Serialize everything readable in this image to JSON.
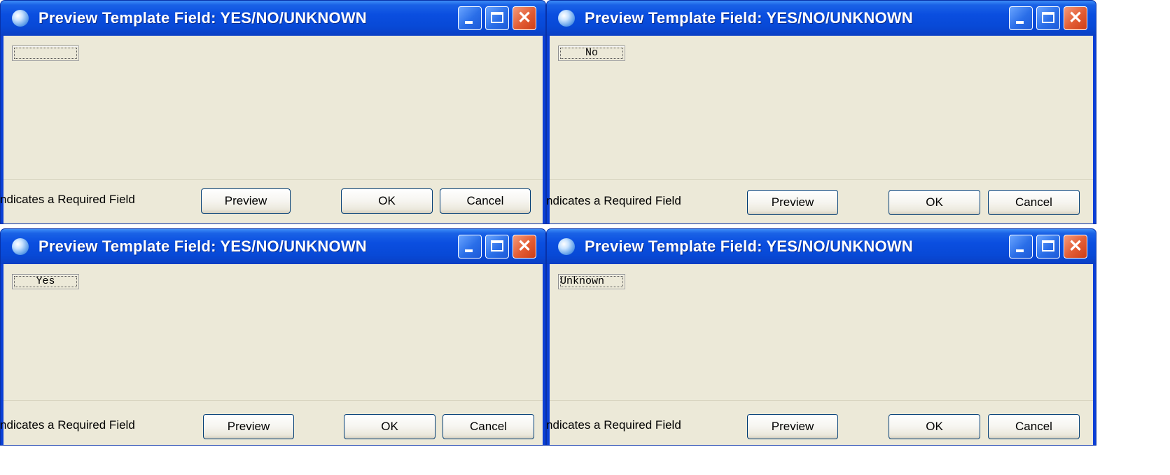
{
  "common": {
    "title": "Preview Template Field: YES/NO/UNKNOWN",
    "required_text": "ndicates a Required Field",
    "preview_label": "Preview",
    "ok_label": "OK",
    "cancel_label": "Cancel",
    "close_glyph": "✕"
  },
  "windows": [
    {
      "field_value": ""
    },
    {
      "field_value": "No"
    },
    {
      "field_value": "Yes"
    },
    {
      "field_value": "Unknown"
    }
  ],
  "colors": {
    "titlebar": "#0a4ee0",
    "client": "#ece9d8",
    "close_button": "#e25b32"
  },
  "icons": [
    "app-icon",
    "minimize-icon",
    "maximize-icon",
    "close-icon"
  ]
}
